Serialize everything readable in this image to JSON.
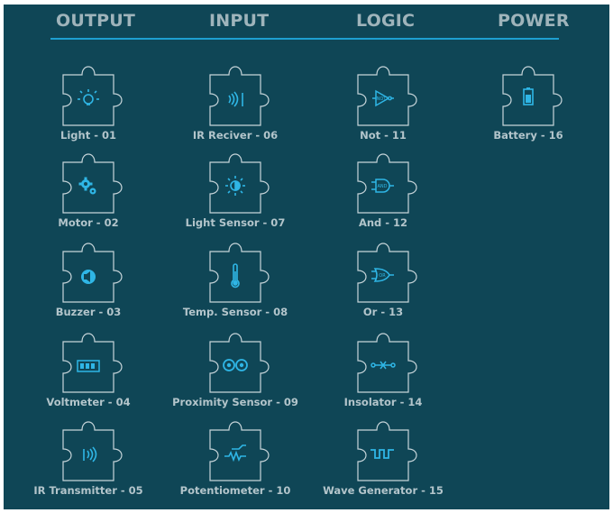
{
  "headers": {
    "output": "OUTPUT",
    "input": "INPUT",
    "logic": "LOGIC",
    "power": "POWER"
  },
  "colors": {
    "background": "#0f4656",
    "accent": "#1e9fd0",
    "piece_outline": "#c7d5da",
    "header_text": "#9fb4bb",
    "label_text": "#b3c5cb"
  },
  "components": [
    {
      "label": "Light - 01",
      "icon": "bulb-icon",
      "group": "output"
    },
    {
      "label": "Motor - 02",
      "icon": "gears-icon",
      "group": "output"
    },
    {
      "label": "Buzzer - 03",
      "icon": "speaker-icon",
      "group": "output"
    },
    {
      "label": "Voltmeter - 04",
      "icon": "battery-level-icon",
      "group": "output"
    },
    {
      "label": "IR Transmitter - 05",
      "icon": "ir-transmitter-icon",
      "group": "output"
    },
    {
      "label": "IR Reciver - 06",
      "icon": "ir-receiver-icon",
      "group": "input"
    },
    {
      "label": "Light Sensor - 07",
      "icon": "half-sun-icon",
      "group": "input"
    },
    {
      "label": "Temp. Sensor - 08",
      "icon": "thermometer-icon",
      "group": "input"
    },
    {
      "label": "Proximity Sensor - 09",
      "icon": "eyes-icon",
      "group": "input"
    },
    {
      "label": "Potentiometer - 10",
      "icon": "potentiometer-icon",
      "group": "input"
    },
    {
      "label": "Not - 11",
      "icon": "not-gate-icon",
      "gate_text": "NOT",
      "group": "logic"
    },
    {
      "label": "And - 12",
      "icon": "and-gate-icon",
      "gate_text": "AND",
      "group": "logic"
    },
    {
      "label": "Or - 13",
      "icon": "or-gate-icon",
      "gate_text": "OR",
      "group": "logic"
    },
    {
      "label": "Insolator - 14",
      "icon": "isolator-icon",
      "group": "logic"
    },
    {
      "label": "Wave Generator - 15",
      "icon": "square-wave-icon",
      "group": "logic"
    },
    {
      "label": "Battery - 16",
      "icon": "battery-icon",
      "group": "power"
    }
  ]
}
